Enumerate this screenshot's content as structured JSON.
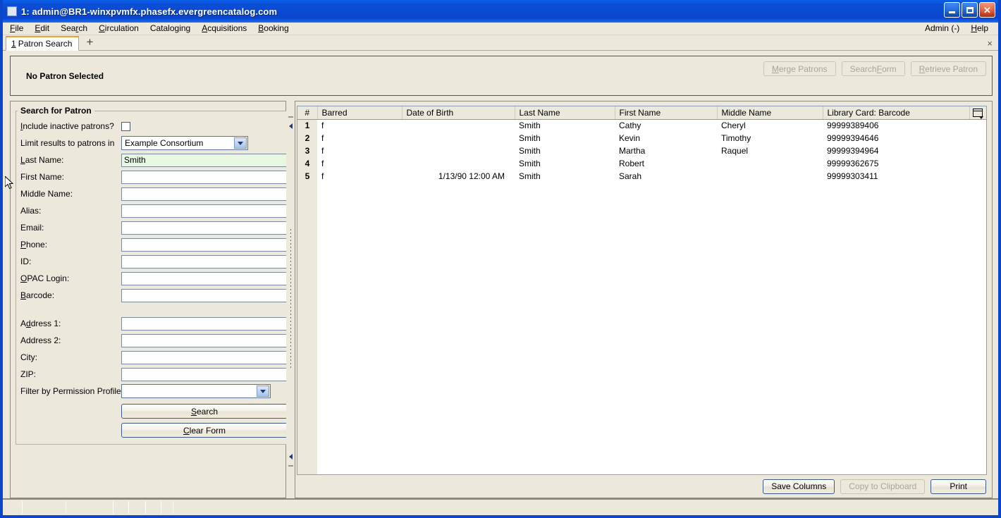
{
  "window": {
    "title": "1: admin@BR1-winxpvmfx.phasefx.evergreencatalog.com",
    "minimize_label": "–",
    "maximize_label": "□",
    "close_label": "✕"
  },
  "menubar": {
    "items": [
      {
        "label": "File",
        "accel": "F"
      },
      {
        "label": "Edit",
        "accel": "E"
      },
      {
        "label": "Search",
        "accel": "r"
      },
      {
        "label": "Circulation",
        "accel": "C"
      },
      {
        "label": "Cataloging",
        "accel": "g"
      },
      {
        "label": "Acquisitions",
        "accel": "A"
      },
      {
        "label": "Booking",
        "accel": "B"
      }
    ],
    "admin_label": "Admin (-)",
    "help_label": "Help"
  },
  "tabs": {
    "active": {
      "number": "1",
      "label": "Patron Search"
    },
    "new_tab_label": "+",
    "close_label": "×"
  },
  "patron_band": {
    "status_text": "No Patron Selected",
    "buttons": [
      {
        "label": "Merge Patrons",
        "enabled": false
      },
      {
        "label": "Search Form",
        "enabled": false
      },
      {
        "label": "Retrieve Patron",
        "enabled": false
      }
    ]
  },
  "search_form": {
    "legend": "Search for Patron",
    "include_inactive_label": "Include inactive patrons?",
    "include_inactive_checked": false,
    "limit_results_label": "Limit results to patrons in",
    "limit_results_value": "Example Consortium",
    "fields": [
      {
        "label": "Last Name:",
        "value": "Smith",
        "active": true
      },
      {
        "label": "First Name:",
        "value": "",
        "active": false
      },
      {
        "label": "Middle Name:",
        "value": "",
        "active": false
      },
      {
        "label": "Alias:",
        "value": "",
        "active": false
      },
      {
        "label": "Email:",
        "value": "",
        "active": false
      },
      {
        "label": "Phone:",
        "value": "",
        "active": false
      },
      {
        "label": "ID:",
        "value": "",
        "active": false
      },
      {
        "label": "OPAC Login:",
        "value": "",
        "active": false
      },
      {
        "label": "Barcode:",
        "value": "",
        "active": false
      }
    ],
    "address_fields": [
      {
        "label": "Address 1:",
        "value": ""
      },
      {
        "label": "Address 2:",
        "value": ""
      },
      {
        "label": "City:",
        "value": ""
      },
      {
        "label": "ZIP:",
        "value": ""
      }
    ],
    "permission_profile_label": "Filter by Permission Profile:",
    "permission_profile_value": "",
    "search_button": "Search",
    "clear_button": "Clear Form"
  },
  "results": {
    "columns": [
      "#",
      "Barred",
      "Date of Birth",
      "Last Name",
      "First Name",
      "Middle Name",
      "Library Card: Barcode"
    ],
    "rows": [
      {
        "num": "1",
        "barred": "f",
        "dob": "",
        "last": "Smith",
        "first": "Cathy",
        "middle": "Cheryl",
        "barcode": "99999389406"
      },
      {
        "num": "2",
        "barred": "f",
        "dob": "",
        "last": "Smith",
        "first": "Kevin",
        "middle": "Timothy",
        "barcode": "99999394646"
      },
      {
        "num": "3",
        "barred": "f",
        "dob": "",
        "last": "Smith",
        "first": "Martha",
        "middle": "Raquel",
        "barcode": "99999394964"
      },
      {
        "num": "4",
        "barred": "f",
        "dob": "",
        "last": "Smith",
        "first": "Robert",
        "middle": "",
        "barcode": "99999362675"
      },
      {
        "num": "5",
        "barred": "f",
        "dob": "1/13/90 12:00 AM",
        "last": "Smith",
        "first": "Sarah",
        "middle": "",
        "barcode": "99999303411"
      }
    ],
    "buttons": [
      {
        "label": "Save Columns",
        "enabled": true
      },
      {
        "label": "Copy to Clipboard",
        "enabled": false
      },
      {
        "label": "Print",
        "enabled": true
      }
    ]
  },
  "colors": {
    "titlebar_blue": "#0a49d0",
    "window_background": "#ece9dc",
    "active_field_green": "#e6f7e2",
    "active_tab_accent": "#f0a02a"
  }
}
